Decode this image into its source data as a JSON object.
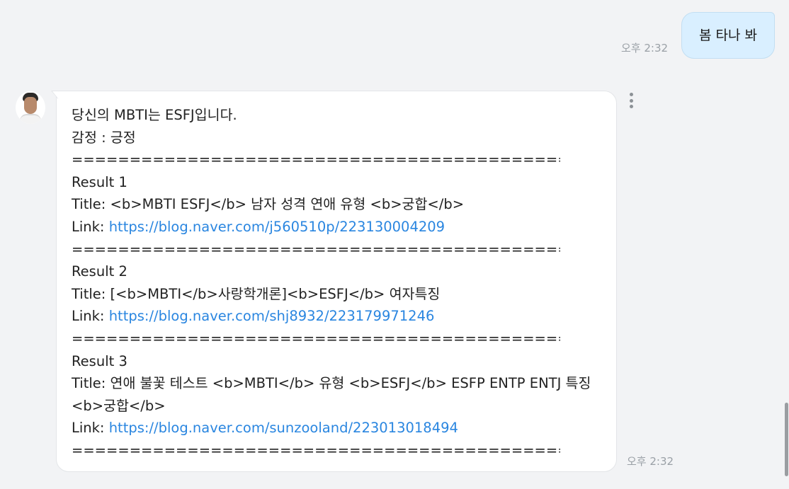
{
  "outgoing": {
    "text": "봄 타나 봐",
    "time": "오후 2:32"
  },
  "incoming": {
    "time": "오후 2:32",
    "lines": {
      "l1": "당신의 MBTI는 ESFJ입니다.",
      "l2": "감정 : 긍정",
      "sep": "=====================================================",
      "r1_title_label": "Result 1",
      "r1_title": "Title: <b>MBTI ESFJ</b> 남자 성격 연애 유형 <b>궁합</b>",
      "r1_link_label": "Link: ",
      "r1_link": "https://blog.naver.com/j560510p/223130004209",
      "r2_title_label": "Result 2",
      "r2_title": "Title: [<b>MBTI</b>사랑학개론]<b>ESFJ</b> 여자특징",
      "r2_link_label": "Link: ",
      "r2_link": "https://blog.naver.com/shj8932/223179971246",
      "r3_title_label": "Result 3",
      "r3_title_a": "Title: 연애 불꽃 테스트 <b>MBTI</b> 유형 <b>ESFJ</b> ESFP ENTP ENTJ 특징",
      "r3_title_b": "<b>궁합</b>",
      "r3_link_label": "Link: ",
      "r3_link": "https://blog.naver.com/sunzooland/223013018494"
    }
  },
  "icons": {
    "more": "more-vertical-icon",
    "avatar": "avatar"
  },
  "colors": {
    "background": "#f2f3f5",
    "outgoing_bubble": "#d9efff",
    "incoming_bubble": "#ffffff",
    "link": "#2a86e0",
    "time": "#9aa0a6"
  }
}
